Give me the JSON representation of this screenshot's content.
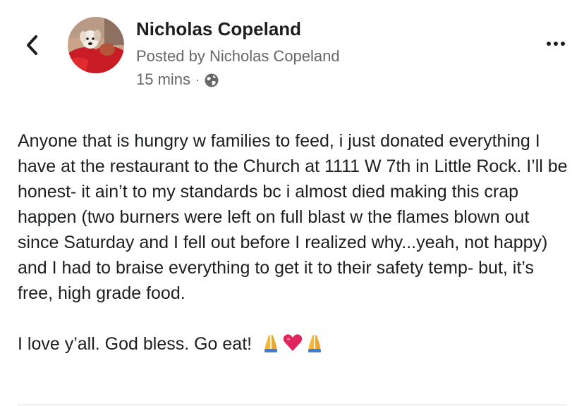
{
  "post": {
    "author": "Nicholas Copeland",
    "posted_by": "Posted by Nicholas Copeland",
    "timestamp": "15 mins",
    "separator": "·",
    "audience_icon": "globe-icon",
    "paragraphs": [
      "Anyone that is hungry w families to feed, i just donated everything I have at the restaurant to the Church at 1111 W 7th in Little Rock. I’ll be honest- it ain’t to my standards bc i almost died making this crap happen (two burners were left on full blast w the flames blown out since Saturday and I fell out before I realized why...yeah, not happy) and I had to braise everything to get it to their safety temp- but, it’s free, high grade food.",
      "I love y’all. God bless. Go eat!"
    ],
    "emojis": [
      "folded-hands-emoji",
      "red-heart-emoji",
      "folded-hands-emoji"
    ]
  },
  "nav": {
    "back_icon": "chevron-left-icon",
    "more_icon": "more-options-icon"
  },
  "colors": {
    "text_primary": "#1c1e21",
    "text_secondary": "#65676b",
    "heart": "#e0245e",
    "folded_hands": "#f5b83d"
  }
}
